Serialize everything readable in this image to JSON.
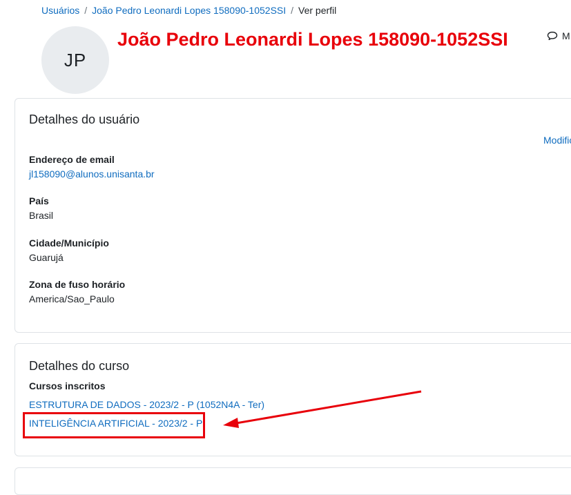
{
  "breadcrumb": {
    "items": [
      "Usuários",
      "João Pedro Leonardi Lopes 158090-1052SSI"
    ],
    "current": "Ver perfil",
    "separator": "/"
  },
  "profile": {
    "initials": "JP",
    "name": "João Pedro Leonardi Lopes 158090-1052SSI",
    "message_label": "M"
  },
  "user_details": {
    "title": "Detalhes do usuário",
    "edit_label": "Modific",
    "fields": [
      {
        "label": "Endereço de email",
        "value": "jl158090@alunos.unisanta.br"
      },
      {
        "label": "País",
        "value": "Brasil"
      },
      {
        "label": "Cidade/Município",
        "value": "Guarujá"
      },
      {
        "label": "Zona de fuso horário",
        "value": "America/Sao_Paulo"
      }
    ]
  },
  "course_details": {
    "title": "Detalhes do curso",
    "enrolled_label": "Cursos inscritos",
    "courses": [
      "ESTRUTURA DE DADOS - 2023/2 - P (1052N4A - Ter)",
      "INTELIGÊNCIA ARTIFICIAL - 2023/2 - P"
    ]
  },
  "colors": {
    "link": "#0f6cbf",
    "annotation": "#e8000a",
    "avatar_bg": "#e9ecef",
    "border": "#dee2e6"
  },
  "icons": {
    "message": "speech-bubble-icon"
  }
}
